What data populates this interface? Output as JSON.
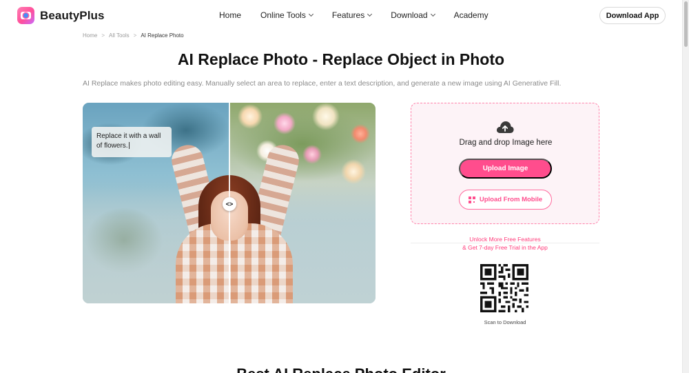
{
  "brand": {
    "name": "BeautyPlus"
  },
  "nav": {
    "items": [
      {
        "label": "Home",
        "dropdown": false
      },
      {
        "label": "Online Tools",
        "dropdown": true
      },
      {
        "label": "Features",
        "dropdown": true
      },
      {
        "label": "Download",
        "dropdown": true
      },
      {
        "label": "Academy",
        "dropdown": false
      }
    ],
    "download_app_label": "Download App"
  },
  "breadcrumb": {
    "items": [
      "Home",
      "All Tools",
      "AI Replace Photo"
    ],
    "separator": ">"
  },
  "page": {
    "title": "AI Replace Photo - Replace Object in Photo",
    "subtitle": "AI Replace makes photo editing easy. Manually select an area to replace, enter a text description, and generate a new image using AI Generative Fill."
  },
  "demo": {
    "prompt_text": "Replace it with a wall of flowers.",
    "handle_glyph": "<>"
  },
  "upload": {
    "drag_text": "Drag and drop Image here",
    "upload_button": "Upload Image",
    "mobile_button": "Upload From Mobile",
    "accent_color": "#ff4d8d"
  },
  "promo": {
    "line1": "Unlock More Free Features",
    "line2": "& Get 7-day Free Trial in the App"
  },
  "qr": {
    "caption": "Scan to Download"
  },
  "next_section": {
    "title": "Best AI Replace Photo Editor"
  }
}
